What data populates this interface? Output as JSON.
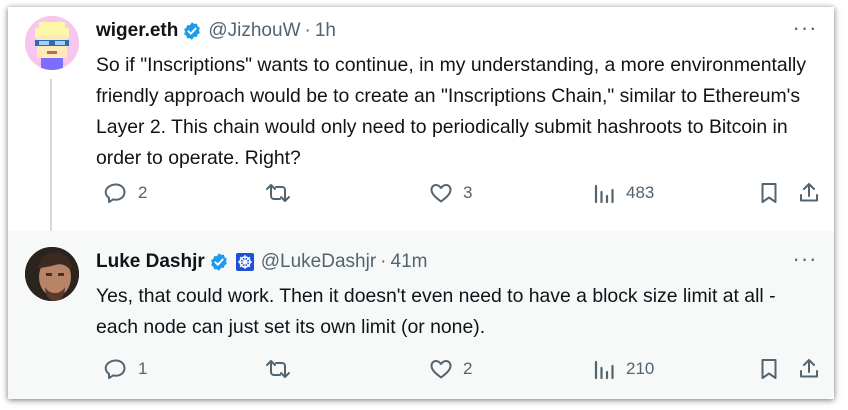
{
  "tweets": [
    {
      "name": "wiger.eth",
      "handle": "@JizhouW",
      "separator": "·",
      "time": "1h",
      "more": "···",
      "text": "So if \"Inscriptions\" wants to continue, in my understanding, a more environmentally friendly approach would be to create an \"Inscriptions Chain,\" similar to Ethereum's Layer 2. This chain would only need to periodically submit hashroots to Bitcoin in order to operate. Right?",
      "replies": "2",
      "retweets": "",
      "likes": "3",
      "views": "483"
    },
    {
      "name": "Luke Dashjr",
      "handle": "@LukeDashjr",
      "separator": "·",
      "time": "41m",
      "more": "···",
      "text": "Yes, that could work. Then it doesn't even need to have a block size limit at all - each node can just set its own limit (or none).",
      "replies": "1",
      "retweets": "",
      "likes": "2",
      "views": "210"
    }
  ],
  "colors": {
    "verified": "#1d9bf0",
    "secondary_text": "#536471",
    "thread_line": "#cfd9de",
    "reply_background": "#f7f9f9"
  },
  "icons": [
    "verified-badge-icon",
    "affiliation-icon",
    "more-icon",
    "reply-icon",
    "retweet-icon",
    "like-icon",
    "views-icon",
    "bookmark-icon",
    "share-icon"
  ]
}
